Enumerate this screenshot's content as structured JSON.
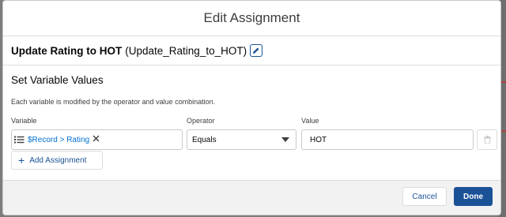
{
  "modal": {
    "title": "Edit Assignment"
  },
  "element": {
    "label": "Update Rating to HOT",
    "api_name": "(Update_Rating_to_HOT)",
    "edit_icon": "pencil-icon"
  },
  "section": {
    "title": "Set Variable Values",
    "description": "Each variable is modified by the operator and value combination."
  },
  "columns": {
    "variable": "Variable",
    "operator": "Operator",
    "value": "Value"
  },
  "assignment": {
    "variable": "$Record > Rating",
    "variable_icon": "list-icon",
    "operator": "Equals",
    "value": "HOT"
  },
  "buttons": {
    "add_assignment": "Add Assignment",
    "cancel": "Cancel",
    "done": "Done"
  },
  "colors": {
    "brand": "#1b5297",
    "link": "#0070d2",
    "border": "#c9c9c9"
  }
}
